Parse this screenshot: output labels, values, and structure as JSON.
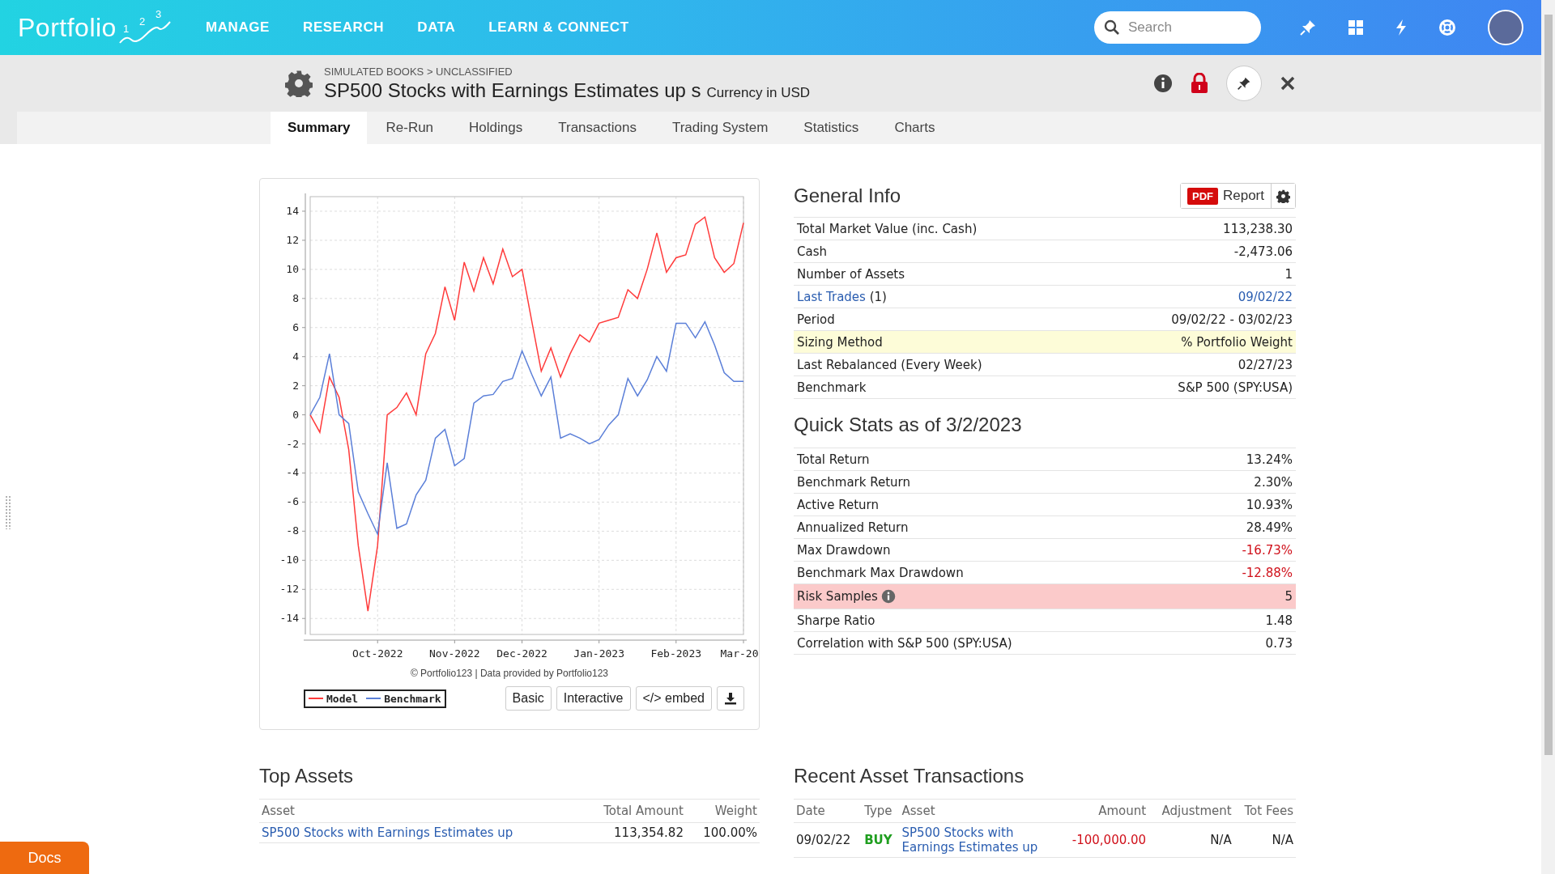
{
  "nav": {
    "logo": {
      "text": "Portfolio",
      "digits": [
        "1",
        "2",
        "3"
      ]
    },
    "items": [
      {
        "label": "MANAGE"
      },
      {
        "label": "RESEARCH"
      },
      {
        "label": "DATA"
      },
      {
        "label": "LEARN & CONNECT"
      }
    ],
    "search": {
      "placeholder": "Search"
    }
  },
  "header": {
    "breadcrumb": "SIMULATED BOOKS > UNCLASSIFIED",
    "title": "SP500 Stocks with Earnings Estimates up s",
    "currency": "Currency in USD"
  },
  "tabs": [
    {
      "label": "Summary",
      "selected": true
    },
    {
      "label": "Re-Run",
      "selected": false
    },
    {
      "label": "Holdings",
      "selected": false
    },
    {
      "label": "Transactions",
      "selected": false
    },
    {
      "label": "Trading System",
      "selected": false
    },
    {
      "label": "Statistics",
      "selected": false
    },
    {
      "label": "Charts",
      "selected": false
    }
  ],
  "chart": {
    "chart_data": {
      "type": "line",
      "categories": [
        null,
        null,
        null,
        null,
        null,
        null,
        null,
        "Oct-2022",
        null,
        null,
        null,
        null,
        null,
        null,
        null,
        "Nov-2022",
        null,
        null,
        null,
        null,
        null,
        null,
        "Dec-2022",
        null,
        null,
        null,
        null,
        null,
        null,
        null,
        "Jan-2023",
        null,
        null,
        null,
        null,
        null,
        null,
        null,
        "Feb-2023",
        null,
        null,
        null,
        null,
        null,
        null,
        "Mar-20"
      ],
      "series": [
        {
          "name": "Model",
          "color": "#ff3b3b",
          "values": [
            0,
            -1.2,
            2.6,
            1.2,
            -2.4,
            -9,
            -13.5,
            -9,
            0,
            0.5,
            1.5,
            0,
            4.2,
            5.6,
            8.8,
            6.5,
            10.5,
            8.5,
            10.8,
            9,
            11.4,
            9.5,
            10,
            6.5,
            3,
            4.6,
            2.6,
            4.2,
            5.5,
            5,
            6.3,
            6.5,
            6.7,
            8.6,
            8,
            10,
            12.5,
            9.8,
            10.8,
            11,
            13.1,
            13.6,
            10.8,
            9.8,
            10.4,
            13.2
          ]
        },
        {
          "name": "Benchmark",
          "color": "#5b7fd8",
          "values": [
            0,
            1.2,
            4.2,
            0,
            -0.6,
            -5.3,
            -6.8,
            -8.2,
            -3.3,
            -7.8,
            -7.5,
            -5.5,
            -4.5,
            -1.6,
            -1,
            -3.5,
            -3,
            0.8,
            1.3,
            1.4,
            2.3,
            2.5,
            4.4,
            2.8,
            1.3,
            2.6,
            -1.6,
            -1.3,
            -1.6,
            -2,
            -1.7,
            -0.7,
            0,
            2.5,
            1.3,
            2.4,
            4,
            3,
            6.3,
            6.3,
            5.3,
            6.4,
            4.8,
            2.9,
            2.3,
            2.3
          ]
        }
      ],
      "ylim": [
        -15.1,
        15
      ],
      "grid": true,
      "yticks": [
        -14,
        -12,
        -10,
        -8,
        -6,
        -4,
        -2,
        0,
        2,
        4,
        6,
        8,
        10,
        12,
        14
      ]
    },
    "credit": "© Portfolio123 | Data provided by Portfolio123",
    "buttons": [
      "Basic",
      "Interactive",
      "</> embed"
    ]
  },
  "general_info": {
    "title": "General Info",
    "pdf_badge": "PDF",
    "report": "Report",
    "rows": [
      {
        "kind": "plain",
        "label": "Total Market Value (inc. Cash)",
        "value": "113,238.30"
      },
      {
        "kind": "plain",
        "label": "Cash",
        "value": "-2,473.06"
      },
      {
        "kind": "plain",
        "label": "Number of Assets",
        "value": "1"
      },
      {
        "kind": "link",
        "label": "Last Trades",
        "suffix": "(1)",
        "value": "09/02/22"
      },
      {
        "kind": "plain",
        "label": "Period",
        "value": "09/02/22 - 03/02/23"
      },
      {
        "kind": "plain",
        "label": "Sizing Method",
        "value": "% Portfolio Weight",
        "color": "#fdfcd8"
      },
      {
        "kind": "plain",
        "label": "Last Rebalanced (Every Week)",
        "value": "02/27/23"
      },
      {
        "kind": "plain",
        "label": "Benchmark",
        "value": "S&P 500 (SPY:USA)"
      }
    ]
  },
  "quick_stats": {
    "title": "Quick Stats as of 3/2/2023",
    "rows": [
      {
        "label": "Total Return",
        "value": "13.24%",
        "negative": false
      },
      {
        "label": "Benchmark Return",
        "value": "2.30%",
        "negative": false
      },
      {
        "label": "Active Return",
        "value": "10.93%",
        "negative": false
      },
      {
        "label": "Annualized Return",
        "value": "28.49%",
        "negative": false
      },
      {
        "label": "Max Drawdown",
        "value": "-16.73%",
        "negative": true
      },
      {
        "label": "Benchmark Max Drawdown",
        "value": "-12.88%",
        "negative": true
      },
      {
        "label": "Risk Samples",
        "value": "5",
        "negative": false,
        "info": true,
        "color": "#fbcaca"
      },
      {
        "label": "Sharpe Ratio",
        "value": "1.48",
        "negative": false
      },
      {
        "label": "Correlation with S&P 500 (SPY:USA)",
        "value": "0.73",
        "negative": false
      }
    ]
  },
  "top_assets": {
    "title": "Top Assets",
    "columns": [
      "Asset",
      "Total Amount",
      "Weight"
    ],
    "rows": [
      {
        "asset": "SP500 Stocks with Earnings Estimates up",
        "total_amount": "113,354.82",
        "weight": "100.00%"
      }
    ]
  },
  "recent_transactions": {
    "title": "Recent Asset Transactions",
    "columns": [
      "Date",
      "Type",
      "Asset",
      "Amount",
      "Adjustment",
      "Tot Fees"
    ],
    "rows": [
      {
        "date": "09/02/22",
        "type": "BUY",
        "kind": "buy",
        "asset": "SP500 Stocks with Earnings Estimates up",
        "amount": "-100,000.00",
        "negative": true,
        "adjustment": "N/A",
        "tot_fees": "N/A"
      }
    ]
  },
  "docs": "Docs"
}
